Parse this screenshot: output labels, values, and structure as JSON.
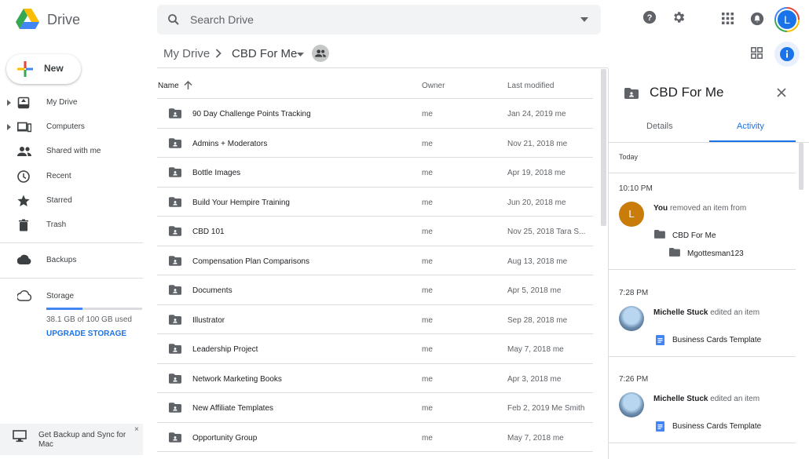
{
  "app": {
    "name": "Drive"
  },
  "search": {
    "placeholder": "Search Drive"
  },
  "header_icons": [
    "help-icon",
    "settings-icon",
    "apps-icon",
    "notifications-icon"
  ],
  "user": {
    "initial": "L"
  },
  "new_button": {
    "label": "New"
  },
  "sidebar": {
    "items": [
      {
        "label": "My Drive",
        "icon": "my-drive-icon"
      },
      {
        "label": "Computers",
        "icon": "computers-icon"
      },
      {
        "label": "Shared with me",
        "icon": "shared-icon"
      },
      {
        "label": "Recent",
        "icon": "clock-icon"
      },
      {
        "label": "Starred",
        "icon": "star-icon"
      },
      {
        "label": "Trash",
        "icon": "trash-icon"
      }
    ],
    "backups": "Backups",
    "storage": {
      "label": "Storage",
      "used_text": "38.1 GB of 100 GB used",
      "used_fraction": 0.381,
      "upgrade": "UPGRADE STORAGE"
    },
    "promo": {
      "text": "Get Backup and Sync for Mac",
      "close": "×"
    }
  },
  "breadcrumb": {
    "parent": "My Drive",
    "current": "CBD For Me"
  },
  "table": {
    "headers": {
      "name": "Name",
      "owner": "Owner",
      "modified": "Last modified"
    },
    "rows": [
      {
        "name": "90 Day Challenge Points Tracking",
        "owner": "me",
        "modified": "Jan 24, 2019",
        "by": "me"
      },
      {
        "name": "Admins + Moderators",
        "owner": "me",
        "modified": "Nov 21, 2018",
        "by": "me"
      },
      {
        "name": "Bottle Images",
        "owner": "me",
        "modified": "Apr 19, 2018",
        "by": "me"
      },
      {
        "name": "Build Your Hempire Training",
        "owner": "me",
        "modified": "Jun 20, 2018",
        "by": "me"
      },
      {
        "name": "CBD 101",
        "owner": "me",
        "modified": "Nov 25, 2018",
        "by": "Tara S..."
      },
      {
        "name": "Compensation Plan Comparisons",
        "owner": "me",
        "modified": "Aug 13, 2018",
        "by": "me"
      },
      {
        "name": "Documents",
        "owner": "me",
        "modified": "Apr 5, 2018",
        "by": "me"
      },
      {
        "name": "Illustrator",
        "owner": "me",
        "modified": "Sep 28, 2018",
        "by": "me"
      },
      {
        "name": "Leadership Project",
        "owner": "me",
        "modified": "May 7, 2018",
        "by": "me"
      },
      {
        "name": "Network Marketing Books",
        "owner": "me",
        "modified": "Apr 3, 2018",
        "by": "me"
      },
      {
        "name": "New Affiliate Templates",
        "owner": "me",
        "modified": "Feb 2, 2019",
        "by": "Me Smith"
      },
      {
        "name": "Opportunity Group",
        "owner": "me",
        "modified": "May 7, 2018",
        "by": "me"
      }
    ]
  },
  "details_panel": {
    "title": "CBD For Me",
    "tabs": [
      "Details",
      "Activity"
    ],
    "active_tab": "Activity",
    "section": "Today",
    "activities": [
      {
        "time": "10:10 PM",
        "avatar_initial": "L",
        "actor": "You",
        "action": "removed an item from",
        "items": [
          "CBD For Me",
          "Mgottesman123"
        ]
      },
      {
        "time": "7:28 PM",
        "actor": "Michelle Stuck",
        "action": "edited an item",
        "items": [
          "Business Cards Template"
        ]
      },
      {
        "time": "7:26 PM",
        "actor": "Michelle Stuck",
        "action": "edited an item",
        "items": [
          "Business Cards Template"
        ]
      }
    ]
  },
  "colors": {
    "accent": "#1a73e8",
    "folder": "#5f6368",
    "doc": "#4285f4"
  }
}
